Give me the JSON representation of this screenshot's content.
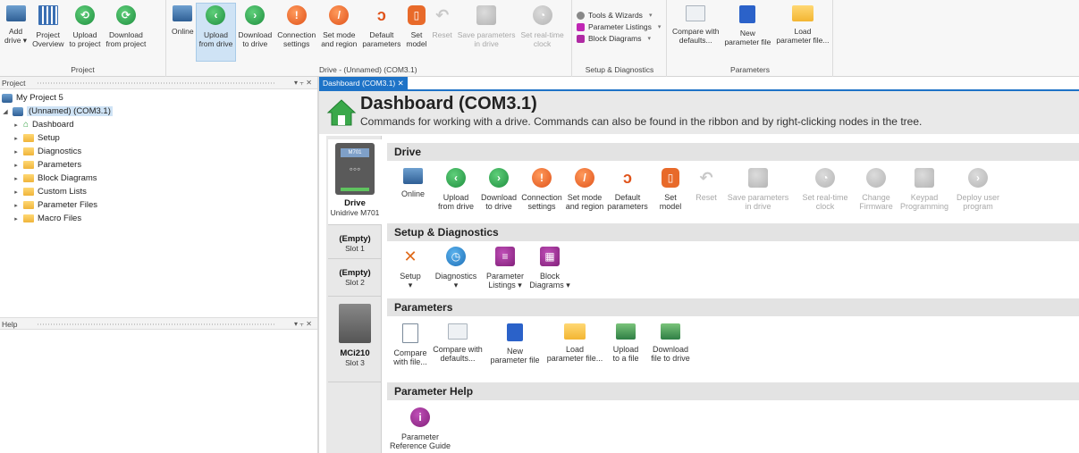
{
  "ribbon": {
    "groups": [
      {
        "title": "Project",
        "buttons": [
          {
            "label": "Add\ndrive ▾",
            "icon": "add-drive-icon"
          },
          {
            "label": "Project\nOverview",
            "icon": "project-overview-icon"
          },
          {
            "label": "Upload\nto project",
            "icon": "upload-icon"
          },
          {
            "label": "Download\nfrom project",
            "icon": "download-icon"
          }
        ]
      },
      {
        "title": "Drive - (Unnamed) (COM3.1)",
        "buttons": [
          {
            "label": "Online",
            "icon": "online-icon"
          },
          {
            "label": "Upload\nfrom drive",
            "icon": "upload-icon"
          },
          {
            "label": "Download\nto drive",
            "icon": "download-icon"
          },
          {
            "label": "Connection\nsettings",
            "icon": "connection-icon"
          },
          {
            "label": "Set mode\nand region",
            "icon": "set-mode-icon"
          },
          {
            "label": "Default\nparameters",
            "icon": "default-params-icon"
          },
          {
            "label": "Set\nmodel",
            "icon": "set-model-icon"
          },
          {
            "label": "Reset",
            "icon": "reset-icon"
          },
          {
            "label": "Save parameters\nin drive",
            "icon": "save-params-icon"
          },
          {
            "label": "Set real-time\nclock",
            "icon": "clock-icon"
          }
        ]
      },
      {
        "title": "Setup & Diagnostics",
        "items": [
          {
            "label": "Tools & Wizards",
            "icon": "tools-icon"
          },
          {
            "label": "Parameter Listings",
            "icon": "param-list-icon"
          },
          {
            "label": "Block Diagrams",
            "icon": "block-diagram-icon"
          }
        ]
      },
      {
        "title": "Parameters",
        "buttons": [
          {
            "label": "Compare with\ndefaults...",
            "icon": "compare-icon"
          },
          {
            "label": "New\nparameter file",
            "icon": "new-file-icon"
          },
          {
            "label": "Load\nparameter file...",
            "icon": "folder-icon"
          }
        ]
      }
    ]
  },
  "project_pane": {
    "title": "Project",
    "controls": "▾ ⫟ ✕",
    "root": "My Project 5",
    "drive": "(Unnamed) (COM3.1)",
    "children": [
      "Dashboard",
      "Setup",
      "Diagnostics",
      "Parameters",
      "Block Diagrams",
      "Custom Lists",
      "Parameter Files",
      "Macro Files"
    ]
  },
  "help_pane": {
    "title": "Help",
    "controls": "▾ ⫟ ✕"
  },
  "doc_tab": {
    "label": "Dashboard (COM3.1)  ✕"
  },
  "dashboard": {
    "title": "Dashboard (COM3.1)",
    "subtitle": "Commands for working with a drive. Commands can also be found in the ribbon and by right-clicking nodes in the tree.",
    "slots": [
      {
        "name": "Drive",
        "sub": "Unidrive M701",
        "screen": "M701"
      },
      {
        "name": "(Empty)",
        "sub": "Slot 1"
      },
      {
        "name": "(Empty)",
        "sub": "Slot 2"
      },
      {
        "name": "MCi210",
        "sub": "Slot 3"
      }
    ],
    "sections": {
      "drive": {
        "title": "Drive",
        "buttons": [
          {
            "label": "Online"
          },
          {
            "label": "Upload\nfrom drive"
          },
          {
            "label": "Download\nto drive"
          },
          {
            "label": "Connection\nsettings"
          },
          {
            "label": "Set mode\nand region"
          },
          {
            "label": "Default\nparameters"
          },
          {
            "label": "Set\nmodel"
          },
          {
            "label": "Reset"
          },
          {
            "label": "Save parameters\nin drive"
          },
          {
            "label": "Set real-time\nclock"
          },
          {
            "label": "Change\nFirmware"
          },
          {
            "label": "Keypad\nProgramming"
          },
          {
            "label": "Deploy user\nprogram"
          }
        ]
      },
      "setup": {
        "title": "Setup & Diagnostics",
        "buttons": [
          {
            "label": "Setup\n▾"
          },
          {
            "label": "Diagnostics\n▾"
          },
          {
            "label": "Parameter\nListings ▾"
          },
          {
            "label": "Block\nDiagrams ▾"
          }
        ]
      },
      "params": {
        "title": "Parameters",
        "buttons": [
          {
            "label": "Compare\nwith file..."
          },
          {
            "label": "Compare with\ndefaults..."
          },
          {
            "label": "New\nparameter file"
          },
          {
            "label": "Load\nparameter file..."
          },
          {
            "label": "Upload\nto a file"
          },
          {
            "label": "Download\nfile to drive"
          }
        ]
      },
      "help": {
        "title": "Parameter Help",
        "buttons": [
          {
            "label": "Parameter\nReference Guide"
          }
        ]
      }
    }
  }
}
